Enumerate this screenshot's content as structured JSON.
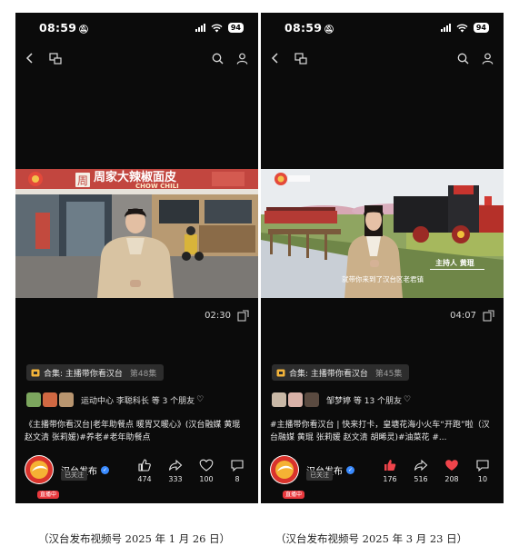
{
  "left": {
    "status_time": "08:59",
    "battery": "94",
    "video": {
      "sign_text": "周家大辣椒面皮",
      "sign_sub": "CHOW CHILI",
      "duration": "02:30"
    },
    "collection_label": "合集: 主播带你看汉台",
    "collection_episode": "第48集",
    "friends_text": "运动中心 李聪科长 等 3 个朋友",
    "description": "《主播带你看汉台|老年助餐点 暖胃又暖心》(汉台融媒 黄琨 赵文清 张莉媛)#养老#老年助餐点",
    "author_name": "汉台发布",
    "follow_label": "已关注",
    "live_badge": "直播中",
    "counts": {
      "like": "474",
      "share": "333",
      "fav": "100",
      "comment": "8"
    },
    "caption": "（汉台发布视频号  2025 年 1 月 26 日）"
  },
  "right": {
    "status_time": "08:59",
    "battery": "94",
    "video": {
      "lower_third_name": "主持人 黄琨",
      "subtitle": "就带你来到了汉台区老君镇",
      "duration": "04:07"
    },
    "collection_label": "合集: 主播带你看汉台",
    "collection_episode": "第45集",
    "friends_text": "邹梦婷 等 13 个朋友",
    "description": "#主播带你看汉台 | 快来打卡，皇塘花海小火车“开跑”啦（汉台融媒 黄琨 张莉媛 赵文清 胡晞灵)#油菜花 #...",
    "author_name": "汉台发布",
    "follow_label": "已关注",
    "live_badge": "直播中",
    "counts": {
      "like": "176",
      "share": "516",
      "fav": "208",
      "comment": "10"
    },
    "caption": "（汉台发布视频号 2025 年 3 月 23 日）"
  },
  "colors": {
    "like_active": "#f0444b",
    "verify": "#3a8bff",
    "live": "#e8383d"
  }
}
